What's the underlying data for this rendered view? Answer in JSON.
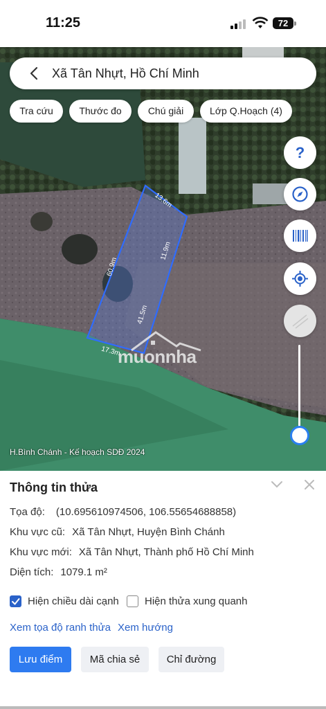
{
  "status": {
    "time": "11:25",
    "battery": "72"
  },
  "search": {
    "query": "Xã Tân Nhựt, Hồ Chí Minh"
  },
  "chips": [
    "Tra cứu",
    "Thước đo",
    "Chú giải",
    "Lớp Q.Hoạch (4)"
  ],
  "fab": {
    "help": "?"
  },
  "map": {
    "caption": "H.Bình Chánh - Kế hoạch SDĐ 2024",
    "watermark": "muonnha",
    "edges": [
      "13.6m",
      "11.9m",
      "60.9m",
      "41.5m",
      "17.3m"
    ],
    "opacity_level": 0.1
  },
  "info": {
    "title": "Thông tin thửa",
    "coord_label": "Tọa độ:",
    "coord_value": "(10.695610974506, 106.55654688858)",
    "old_area_label": "Khu vực cũ:",
    "old_area_value": "Xã Tân Nhựt, Huyện Bình Chánh",
    "new_area_label": "Khu vực mới:",
    "new_area_value": "Xã Tân Nhựt, Thành phố Hồ Chí Minh",
    "size_label": "Diện tích:",
    "size_value": "1079.1 m²",
    "cb_edges": "Hiện chiều dài cạnh",
    "cb_neighbors": "Hiện thửa xung quanh",
    "link_coords": "Xem tọa độ ranh thửa",
    "link_direction": "Xem hướng",
    "btn_save": "Lưu điểm",
    "btn_share": "Mã chia sẻ",
    "btn_route": "Chỉ đường"
  },
  "colors": {
    "accent": "#2e7bf0",
    "parcel": "#2f6cff"
  }
}
